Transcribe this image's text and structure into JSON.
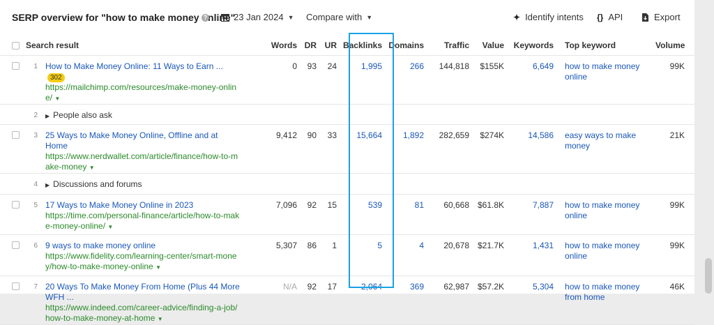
{
  "toolbar": {
    "title": "SERP overview for \"how to make money online\"",
    "help": "?",
    "date": "23 Jan 2024",
    "compare": "Compare with",
    "identify": "Identify intents",
    "api": "API",
    "export": "Export"
  },
  "columns": {
    "search_result": "Search result",
    "words": "Words",
    "dr": "DR",
    "ur": "UR",
    "backlinks": "Backlinks",
    "domains": "Domains",
    "traffic": "Traffic",
    "value": "Value",
    "keywords": "Keywords",
    "top_keyword": "Top keyword",
    "volume": "Volume"
  },
  "rows": [
    {
      "n": "1",
      "title": "How to Make Money Online: 11 Ways to Earn ...",
      "badge": "302",
      "url": "https://mailchimp.com/resources/make-money-online/",
      "words": "0",
      "dr": "93",
      "ur": "24",
      "backlinks": "1,995",
      "domains": "266",
      "traffic": "144,818",
      "value": "$155K",
      "keywords": "6,649",
      "top_keyword": "how to make money online",
      "volume": "99K"
    },
    {
      "n": "2",
      "label": "People also ask"
    },
    {
      "n": "3",
      "title": "25 Ways to Make Money Online, Offline and at Home",
      "url": "https://www.nerdwallet.com/article/finance/how-to-make-money",
      "words": "9,412",
      "dr": "90",
      "ur": "33",
      "backlinks": "15,664",
      "domains": "1,892",
      "traffic": "282,659",
      "value": "$274K",
      "keywords": "14,586",
      "top_keyword": "easy ways to make money",
      "volume": "21K"
    },
    {
      "n": "4",
      "label": "Discussions and forums"
    },
    {
      "n": "5",
      "title": "17 Ways to Make Money Online in 2023",
      "url": "https://time.com/personal-finance/article/how-to-make-money-online/",
      "words": "7,096",
      "dr": "92",
      "ur": "15",
      "backlinks": "539",
      "domains": "81",
      "traffic": "60,668",
      "value": "$61.8K",
      "keywords": "7,887",
      "top_keyword": "how to make money online",
      "volume": "99K"
    },
    {
      "n": "6",
      "title": "9 ways to make money online",
      "url": "https://www.fidelity.com/learning-center/smart-money/how-to-make-money-online",
      "words": "5,307",
      "dr": "86",
      "ur": "1",
      "backlinks": "5",
      "domains": "4",
      "traffic": "20,678",
      "value": "$21.7K",
      "keywords": "1,431",
      "top_keyword": "how to make money online",
      "volume": "99K"
    },
    {
      "n": "7",
      "title": "20 Ways To Make Money From Home (Plus 44 More WFH ...",
      "url": "https://www.indeed.com/career-advice/finding-a-job/how-to-make-money-at-home",
      "words": "N/A",
      "dr": "92",
      "ur": "17",
      "backlinks": "2,064",
      "domains": "369",
      "traffic": "62,987",
      "value": "$57.2K",
      "keywords": "5,304",
      "top_keyword": "how to make money from home",
      "volume": "46K"
    }
  ],
  "colors": {
    "link": "#1a57b8",
    "url": "#2b8a2b",
    "highlight": "#1aa1e6",
    "badge": "#f4cc12"
  }
}
